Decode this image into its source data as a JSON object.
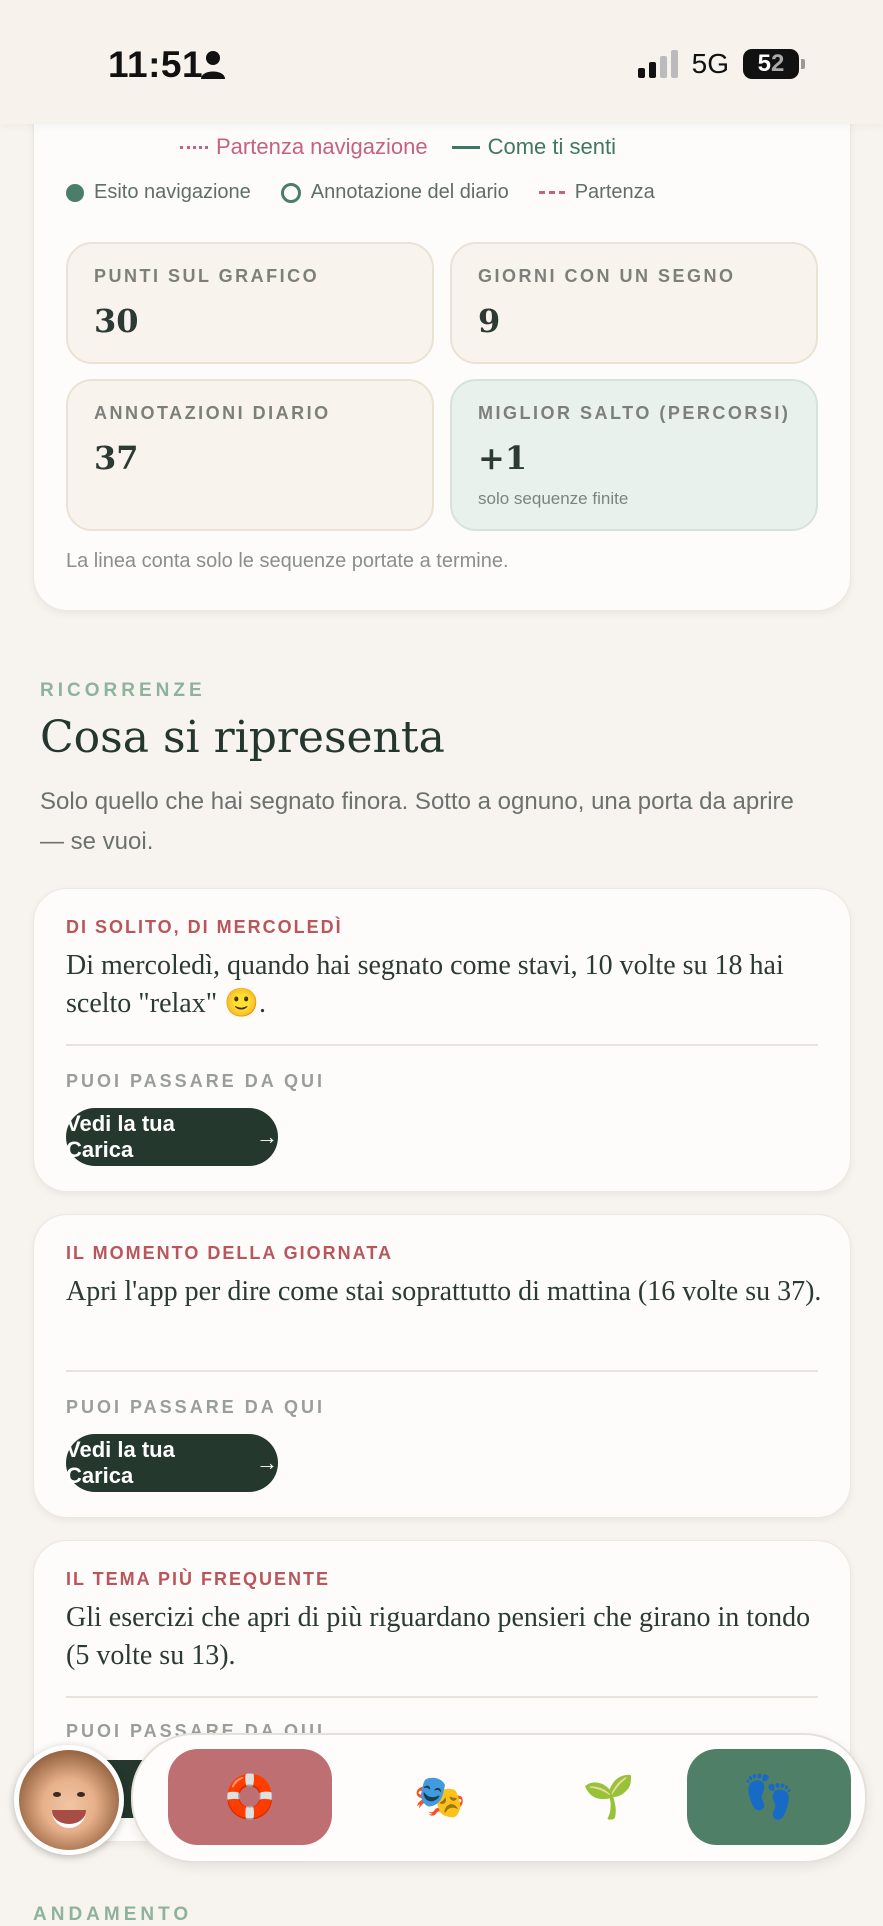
{
  "status_bar": {
    "time": "11:51",
    "network": "5G",
    "battery": "52",
    "battery_a": "5",
    "battery_b": "2"
  },
  "chart_legend": {
    "row1": [
      {
        "label": "Partenza navigazione",
        "style": "dotted",
        "color": "#c56283"
      },
      {
        "label": "Come ti senti",
        "style": "solid",
        "color": "#3f7766"
      }
    ],
    "row2": [
      {
        "label": "Esito navigazione",
        "marker": "filled-dot",
        "color": "#4b7d6b"
      },
      {
        "label": "Annotazione del diario",
        "marker": "ring",
        "color": "#4b7d6b"
      },
      {
        "label": "Partenza",
        "marker": "dashed",
        "color": "#c56283"
      }
    ]
  },
  "stats": [
    {
      "label": "PUNTI SUL GRAFICO",
      "value": "30"
    },
    {
      "label": "GIORNI CON UN SEGNO",
      "value": "9"
    },
    {
      "label": "ANNOTAZIONI DIARIO",
      "value": "37"
    },
    {
      "label": "MIGLIOR SALTO (PERCORSI)",
      "value": "+1",
      "note": "solo sequenze finite"
    }
  ],
  "footnote": "La linea conta solo le sequenze portate a termine.",
  "section": {
    "eyebrow": "RICORRENZE",
    "title": "Cosa si ripresenta",
    "description": "Solo quello che hai segnato finora. Sotto a ognuno, una porta da aprire — se vuoi."
  },
  "recurrences": [
    {
      "eyebrow": "DI SOLITO, DI MERCOLEDÌ",
      "text": "Di mercoledì, quando hai segnato come stavi, 10 volte su 18 hai scelto \"relax\" 🙂.",
      "sub": "PUOI PASSARE DA QUI",
      "button": "Vedi la tua Carica"
    },
    {
      "eyebrow": "IL MOMENTO DELLA GIORNATA",
      "text": "Apri l'app per dire come stai soprattutto di mattina (16 volte su 37).",
      "sub": "PUOI PASSARE DA QUI",
      "button": "Vedi la tua Carica"
    },
    {
      "eyebrow": "IL TEMA PIÙ FREQUENTE",
      "text": "Gli esercizi che apri di più riguardano pensieri che girano in tondo (5 volte su 13).",
      "sub": "PUOI PASSARE DA QUI"
    }
  ],
  "next_section": "ANDAMENTO",
  "bottom_nav": [
    {
      "icon": "lifebuoy-icon",
      "glyph": "🛟",
      "active": true,
      "color": "#bd6f72"
    },
    {
      "icon": "theater-masks-icon",
      "glyph": "🎭"
    },
    {
      "icon": "seedling-icon",
      "glyph": "🌱"
    },
    {
      "icon": "footprints-icon",
      "glyph": "👣",
      "color": "#4f7f66"
    }
  ]
}
